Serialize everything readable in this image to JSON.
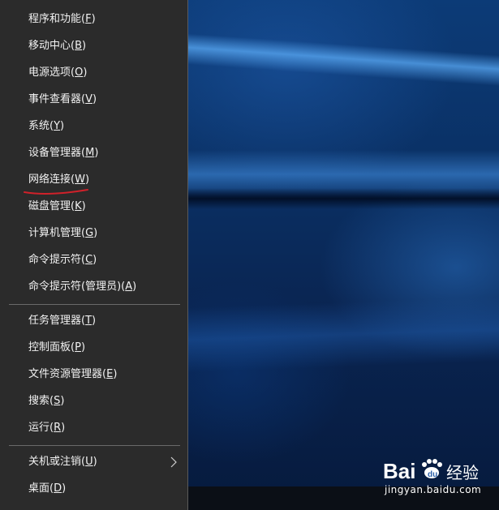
{
  "menu": {
    "items": [
      {
        "label": "程序和功能",
        "key": "F"
      },
      {
        "label": "移动中心",
        "key": "B"
      },
      {
        "label": "电源选项",
        "key": "O"
      },
      {
        "label": "事件查看器",
        "key": "V"
      },
      {
        "label": "系统",
        "key": "Y"
      },
      {
        "label": "设备管理器",
        "key": "M"
      },
      {
        "label": "网络连接",
        "key": "W"
      },
      {
        "label": "磁盘管理",
        "key": "K"
      },
      {
        "label": "计算机管理",
        "key": "G"
      },
      {
        "label": "命令提示符",
        "key": "C"
      },
      {
        "label": "命令提示符(管理员)",
        "key": "A"
      },
      {
        "label": "任务管理器",
        "key": "T"
      },
      {
        "label": "控制面板",
        "key": "P"
      },
      {
        "label": "文件资源管理器",
        "key": "E"
      },
      {
        "label": "搜索",
        "key": "S"
      },
      {
        "label": "运行",
        "key": "R"
      },
      {
        "label": "关机或注销",
        "key": "U"
      },
      {
        "label": "桌面",
        "key": "D"
      }
    ],
    "highlighted_item": "网络连接(W)",
    "submenu_arrow_icon": "chevron-right-icon"
  },
  "colors": {
    "menu_background": "#2b2b2b",
    "menu_text": "#f2f2f2",
    "annotation_red": "#d0212a",
    "wallpaper_blue": "#0c3b77"
  },
  "watermark": {
    "brand": "Bai",
    "brand_suffix": "经验",
    "url": "jingyan.baidu.com"
  }
}
